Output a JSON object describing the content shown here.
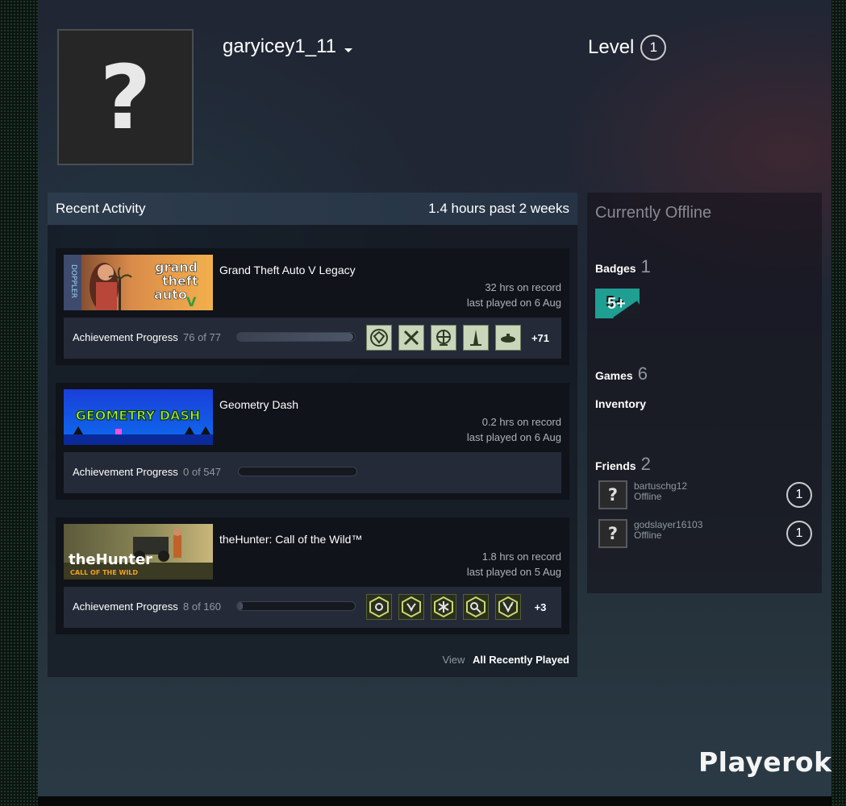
{
  "profile": {
    "username": "garyicey1_11",
    "avatar_placeholder": "?",
    "level_label": "Level",
    "level_value": "1"
  },
  "activity": {
    "title": "Recent Activity",
    "hours_summary": "1.4 hours past 2 weeks",
    "view_label": "View",
    "all_recent_label": "All Recently Played",
    "games": [
      {
        "name": "Grand Theft Auto V Legacy",
        "capsule_text": [
          "grand",
          "theft",
          "auto",
          "DOPPLER"
        ],
        "hours": "32 hrs on record",
        "last_played": "last played on 6 Aug",
        "achievement_label": "Achievement Progress",
        "achievement_count": "76 of 77",
        "achievement_progress": 0.987,
        "icons": [
          "diamond-icon",
          "crossed-tools-icon",
          "globe-icon",
          "tower-icon",
          "submarine-icon"
        ],
        "more": "+71"
      },
      {
        "name": "Geometry Dash",
        "capsule_text": [
          "GEOMETRY DASH"
        ],
        "hours": "0.2 hrs on record",
        "last_played": "last played on 6 Aug",
        "achievement_label": "Achievement Progress",
        "achievement_count": "0 of 547",
        "achievement_progress": 0,
        "icons": [],
        "more": ""
      },
      {
        "name": "theHunter: Call of the Wild™",
        "capsule_text": [
          "theHunter",
          "CALL OF THE WILD"
        ],
        "hours": "1.8 hrs on record",
        "last_played": "last played on 5 Aug",
        "achievement_label": "Achievement Progress",
        "achievement_count": "8 of 160",
        "achievement_progress": 0.05,
        "icons": [
          "target-badge-icon",
          "deer-badge-icon",
          "snowflake-badge-icon",
          "binoculars-badge-icon",
          "antlers-badge-icon"
        ],
        "more": "+3"
      }
    ]
  },
  "sidebar": {
    "status": "Currently Offline",
    "badges_label": "Badges",
    "badges_count": "1",
    "badge_text": "5+",
    "games_label": "Games",
    "games_count": "6",
    "inventory_label": "Inventory",
    "friends_label": "Friends",
    "friends_count": "2",
    "friends": [
      {
        "name": "bartuschg12",
        "status": "Offline",
        "level": "1",
        "avatar": "?"
      },
      {
        "name": "godslayer16103",
        "status": "Offline",
        "level": "1",
        "avatar": "?"
      }
    ]
  },
  "watermark": "Playerok",
  "colors": {
    "badge_teal": "#1f9e92",
    "accent_gta_icon": "#c9d6b9",
    "hunter_icon": "#c8d96a"
  }
}
